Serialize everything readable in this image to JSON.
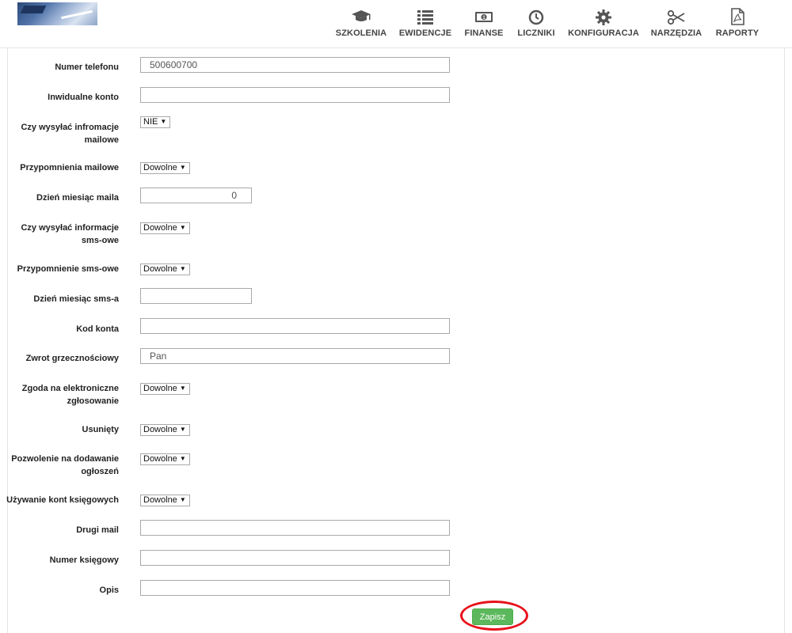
{
  "nav": {
    "items": [
      {
        "label": "SZKOLENIA",
        "icon": "graduation-cap-icon"
      },
      {
        "label": "EWIDENCJE",
        "icon": "list-icon"
      },
      {
        "label": "FINANSE",
        "icon": "banknote-icon"
      },
      {
        "label": "LICZNIKI",
        "icon": "clock-icon"
      },
      {
        "label": "KONFIGURACJA",
        "icon": "gear-icon"
      },
      {
        "label": "NARZĘDZIA",
        "icon": "scissors-icon"
      },
      {
        "label": "RAPORTY",
        "icon": "pdf-document-icon"
      }
    ]
  },
  "form": {
    "phone": {
      "label": "Numer telefonu",
      "value": "500600700"
    },
    "individual_account": {
      "label": "Inwidualne konto",
      "value": ""
    },
    "send_email_info": {
      "label_line1": "Czy wysyłać infromacje",
      "label_line2": "mailowe",
      "value": "NIE"
    },
    "email_reminders": {
      "label": "Przypomnienia mailowe",
      "value": "Dowolne"
    },
    "email_day_month": {
      "label": "Dzień miesiąc maila",
      "value": "0"
    },
    "send_sms_info": {
      "label_line1": "Czy wysyłać informacje",
      "label_line2": "sms-owe",
      "value": "Dowolne"
    },
    "sms_reminder": {
      "label": "Przypomnienie sms-owe",
      "value": "Dowolne"
    },
    "sms_day_month": {
      "label": "Dzień miesiąc sms-a",
      "value": ""
    },
    "account_code": {
      "label": "Kod konta",
      "value": ""
    },
    "salutation": {
      "label": "Zwrot grzecznościowy",
      "value": "Pan"
    },
    "electronic_consent": {
      "label_line1": "Zgoda na elektroniczne",
      "label_line2": "zgłosowanie",
      "value": "Dowolne"
    },
    "deleted": {
      "label": "Usunięty",
      "value": "Dowolne"
    },
    "ads_permission": {
      "label_line1": "Pozwolenie na dodawanie",
      "label_line2": "ogłoszeń",
      "value": "Dowolne"
    },
    "accounting_accounts": {
      "label": "Używanie kont księgowych",
      "value": "Dowolne"
    },
    "second_email": {
      "label": "Drugi mail",
      "value": ""
    },
    "accounting_number": {
      "label": "Numer księgowy",
      "value": ""
    },
    "description": {
      "label": "Opis",
      "value": ""
    }
  },
  "save_label": "Zapisz",
  "colors": {
    "save_button": "#5cb85c",
    "highlight_ring": "#e8101a"
  }
}
